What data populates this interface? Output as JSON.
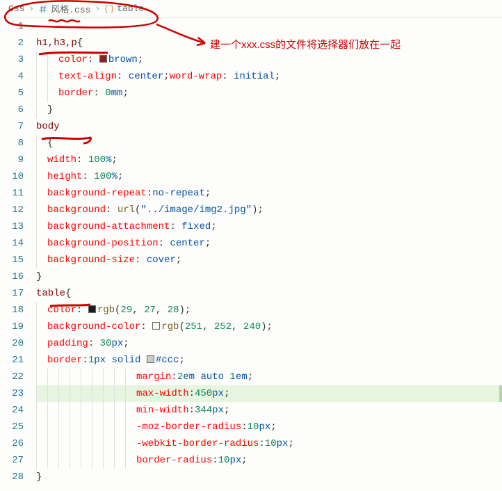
{
  "breadcrumb": {
    "items": [
      {
        "label": "Css",
        "icon": ""
      },
      {
        "label": "风格.css",
        "icon": "hash"
      },
      {
        "label": "table",
        "icon": "braces"
      }
    ],
    "sep": "›"
  },
  "annotation": {
    "text": "建一个xxx.css的文件将选择器们放在一起"
  },
  "code": {
    "lines": [
      {
        "n": 1,
        "tokens": []
      },
      {
        "n": 2,
        "tokens": [
          [
            "sel",
            "h1,h3,p"
          ],
          [
            "punc",
            "{"
          ]
        ]
      },
      {
        "n": 3,
        "tokens": [
          [
            "ind",
            2
          ],
          [
            "prop",
            "color"
          ],
          [
            "punc",
            ": "
          ],
          [
            "color",
            "#8B2323"
          ],
          [
            "val",
            "brown"
          ],
          [
            "punc",
            ";"
          ]
        ]
      },
      {
        "n": 4,
        "tokens": [
          [
            "ind",
            2
          ],
          [
            "prop",
            "text-align"
          ],
          [
            "punc",
            ": "
          ],
          [
            "val",
            "center"
          ],
          [
            "punc",
            ";"
          ],
          [
            "prop",
            "word-wrap"
          ],
          [
            "punc",
            ": "
          ],
          [
            "val",
            "initial"
          ],
          [
            "punc",
            ";"
          ]
        ]
      },
      {
        "n": 5,
        "tokens": [
          [
            "ind",
            2
          ],
          [
            "prop",
            "border"
          ],
          [
            "punc",
            ": "
          ],
          [
            "num",
            "0"
          ],
          [
            "val",
            "mm"
          ],
          [
            "punc",
            ";"
          ]
        ]
      },
      {
        "n": 6,
        "tokens": [
          [
            "ind",
            1
          ],
          [
            "punc",
            "}"
          ]
        ]
      },
      {
        "n": 7,
        "tokens": [
          [
            "sel",
            "body"
          ]
        ]
      },
      {
        "n": 8,
        "tokens": [
          [
            "ind",
            1
          ],
          [
            "punc",
            "{"
          ]
        ]
      },
      {
        "n": 9,
        "tokens": [
          [
            "ind",
            1
          ],
          [
            "prop",
            "width"
          ],
          [
            "punc",
            ": "
          ],
          [
            "num",
            "100"
          ],
          [
            "val",
            "%"
          ],
          [
            "punc",
            ";"
          ]
        ]
      },
      {
        "n": 10,
        "tokens": [
          [
            "ind",
            1
          ],
          [
            "prop",
            "height"
          ],
          [
            "punc",
            ": "
          ],
          [
            "num",
            "100"
          ],
          [
            "val",
            "%"
          ],
          [
            "punc",
            ";"
          ]
        ]
      },
      {
        "n": 11,
        "tokens": [
          [
            "ind",
            1
          ],
          [
            "prop",
            "background-repeat"
          ],
          [
            "punc",
            ":"
          ],
          [
            "val",
            "no-repeat"
          ],
          [
            "punc",
            ";"
          ]
        ]
      },
      {
        "n": 12,
        "tokens": [
          [
            "ind",
            1
          ],
          [
            "prop",
            "background"
          ],
          [
            "punc",
            ": "
          ],
          [
            "func",
            "url"
          ],
          [
            "punc",
            "("
          ],
          [
            "str",
            "\"../image/img2.jpg\""
          ],
          [
            "punc",
            ");"
          ]
        ]
      },
      {
        "n": 13,
        "tokens": [
          [
            "ind",
            1
          ],
          [
            "prop",
            "background-attachment"
          ],
          [
            "punc",
            ": "
          ],
          [
            "val",
            "fixed"
          ],
          [
            "punc",
            ";"
          ]
        ]
      },
      {
        "n": 14,
        "tokens": [
          [
            "ind",
            1
          ],
          [
            "prop",
            "background-position"
          ],
          [
            "punc",
            ": "
          ],
          [
            "val",
            "center"
          ],
          [
            "punc",
            ";"
          ]
        ]
      },
      {
        "n": 15,
        "tokens": [
          [
            "ind",
            1
          ],
          [
            "prop",
            "background-size"
          ],
          [
            "punc",
            ": "
          ],
          [
            "val",
            "cover"
          ],
          [
            "punc",
            ";"
          ]
        ]
      },
      {
        "n": 16,
        "tokens": [
          [
            "ind",
            0
          ],
          [
            "punc",
            "}"
          ]
        ]
      },
      {
        "n": 17,
        "tokens": [
          [
            "sel",
            "table"
          ],
          [
            "punc",
            "{"
          ]
        ]
      },
      {
        "n": 18,
        "tokens": [
          [
            "ind",
            1
          ],
          [
            "prop",
            "color"
          ],
          [
            "punc",
            ": "
          ],
          [
            "color",
            "#1D1B1C"
          ],
          [
            "func",
            "rgb"
          ],
          [
            "punc",
            "("
          ],
          [
            "num",
            "29"
          ],
          [
            "punc",
            ", "
          ],
          [
            "num",
            "27"
          ],
          [
            "punc",
            ", "
          ],
          [
            "num",
            "28"
          ],
          [
            "punc",
            ");"
          ]
        ]
      },
      {
        "n": 19,
        "tokens": [
          [
            "ind",
            1
          ],
          [
            "prop",
            "background-color"
          ],
          [
            "punc",
            ": "
          ],
          [
            "color",
            "#FBFCF0"
          ],
          [
            "func",
            "rgb"
          ],
          [
            "punc",
            "("
          ],
          [
            "num",
            "251"
          ],
          [
            "punc",
            ", "
          ],
          [
            "num",
            "252"
          ],
          [
            "punc",
            ", "
          ],
          [
            "num",
            "240"
          ],
          [
            "punc",
            ");"
          ]
        ]
      },
      {
        "n": 20,
        "tokens": [
          [
            "ind",
            1
          ],
          [
            "prop",
            "padding"
          ],
          [
            "punc",
            ": "
          ],
          [
            "num",
            "30"
          ],
          [
            "val",
            "px"
          ],
          [
            "punc",
            ";"
          ]
        ]
      },
      {
        "n": 21,
        "tokens": [
          [
            "ind",
            1
          ],
          [
            "prop",
            "border"
          ],
          [
            "punc",
            ":"
          ],
          [
            "num",
            "1"
          ],
          [
            "val",
            "px "
          ],
          [
            "val",
            "solid "
          ],
          [
            "color",
            "#cccccc"
          ],
          [
            "val",
            "#ccc"
          ],
          [
            "punc",
            ";"
          ]
        ]
      },
      {
        "n": 22,
        "tokens": [
          [
            "ind",
            9
          ],
          [
            "prop",
            "margin"
          ],
          [
            "punc",
            ":"
          ],
          [
            "num",
            "2"
          ],
          [
            "val",
            "em "
          ],
          [
            "val",
            "auto "
          ],
          [
            "num",
            "1"
          ],
          [
            "val",
            "em"
          ],
          [
            "punc",
            ";"
          ]
        ]
      },
      {
        "n": 23,
        "hl": true,
        "tokens": [
          [
            "ind",
            9
          ],
          [
            "prop",
            "max-width"
          ],
          [
            "punc",
            ":"
          ],
          [
            "num",
            "450"
          ],
          [
            "val",
            "px"
          ],
          [
            "punc",
            ";"
          ]
        ]
      },
      {
        "n": 24,
        "tokens": [
          [
            "ind",
            9
          ],
          [
            "prop",
            "min-width"
          ],
          [
            "punc",
            ":"
          ],
          [
            "num",
            "344"
          ],
          [
            "val",
            "px"
          ],
          [
            "punc",
            ";"
          ]
        ]
      },
      {
        "n": 25,
        "tokens": [
          [
            "ind",
            9
          ],
          [
            "prop",
            "-moz-border-radius"
          ],
          [
            "punc",
            ":"
          ],
          [
            "num",
            "10"
          ],
          [
            "val",
            "px"
          ],
          [
            "punc",
            ";"
          ]
        ]
      },
      {
        "n": 26,
        "tokens": [
          [
            "ind",
            9
          ],
          [
            "prop",
            "-webkit-border-radius"
          ],
          [
            "punc",
            ":"
          ],
          [
            "num",
            "10"
          ],
          [
            "val",
            "px"
          ],
          [
            "punc",
            ";"
          ]
        ]
      },
      {
        "n": 27,
        "tokens": [
          [
            "ind",
            9
          ],
          [
            "prop",
            "border-radius"
          ],
          [
            "punc",
            ":"
          ],
          [
            "num",
            "10"
          ],
          [
            "val",
            "px"
          ],
          [
            "punc",
            ";"
          ]
        ]
      },
      {
        "n": 28,
        "tokens": [
          [
            "ind",
            0
          ],
          [
            "punc",
            "}"
          ]
        ]
      }
    ]
  }
}
